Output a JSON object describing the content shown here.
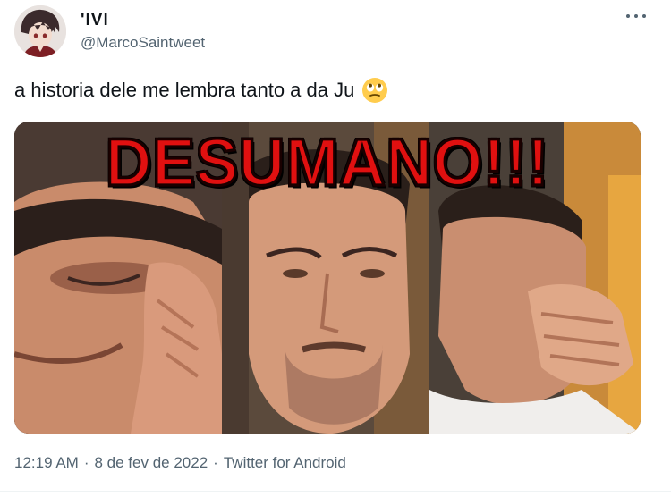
{
  "author": {
    "display_name": "'lVl",
    "handle": "@MarcoSaintweet"
  },
  "tweet": {
    "text": "a historia dele me lembra tanto a da Ju",
    "emoji": "face-with-rolling-eyes"
  },
  "media": {
    "overlay_text": "DESUMANO!!!",
    "overlay_color": "#e01010",
    "panels": 3
  },
  "meta": {
    "time": "12:19 AM",
    "date": "8 de fev de 2022",
    "source": "Twitter for Android",
    "separator": "·"
  },
  "colors": {
    "text_primary": "#0f1419",
    "text_secondary": "#536471"
  }
}
